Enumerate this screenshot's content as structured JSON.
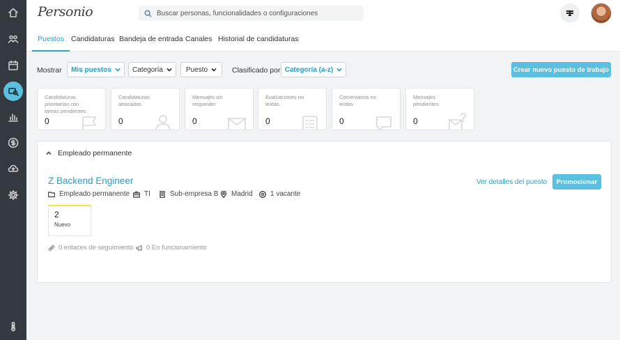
{
  "colors": {
    "accent": "#2a9fc9",
    "button": "#5bbfe0",
    "rail": "#34393f",
    "stage_accent": "#f3e244"
  },
  "rail": [
    {
      "icon": "home-icon"
    },
    {
      "icon": "people-icon"
    },
    {
      "icon": "calendar-icon"
    },
    {
      "icon": "recruiting-icon",
      "active": true
    },
    {
      "icon": "analytics-icon"
    },
    {
      "icon": "payroll-icon"
    },
    {
      "icon": "cloud-upload-icon"
    },
    {
      "icon": "settings-icon"
    },
    {
      "icon": "thermometer-icon"
    }
  ],
  "header": {
    "logo": "Personio",
    "search_placeholder": "Buscar personas, funcionalidades o configuraciones"
  },
  "tabs": [
    "Puestos",
    "Candidaturas",
    "Bandeja de entrada",
    "Canales",
    "Historial de candidaturas"
  ],
  "filters": {
    "show_label": "Mostrar",
    "my_jobs": "Mis puestos",
    "category": "Categoría",
    "job": "Puesto",
    "sort_label": "Clasificado por",
    "sort_value": "Categoría (a-z)",
    "create_button": "Crear nuevo puesto de trabajo"
  },
  "stats": [
    {
      "label": "Candidaturas prioritarias con tareas pendientes",
      "value": "0",
      "icon": "flag-icon"
    },
    {
      "label": "Candidaturas atrasadas",
      "value": "0",
      "icon": "person-icon"
    },
    {
      "label": "Mensajes sin responder",
      "value": "0",
      "icon": "envelope-icon"
    },
    {
      "label": "Evaluaciones no leídas",
      "value": "0",
      "icon": "clipboard-icon"
    },
    {
      "label": "Comentarios no leídos",
      "value": "0",
      "icon": "comment-icon"
    },
    {
      "label": "Mensajes pendientes",
      "value": "0",
      "icon": "envelope-question-icon"
    }
  ],
  "section": {
    "title": "Empleado permanente",
    "job": {
      "title": "Z Backend Engineer",
      "employment": "Empleado permanente",
      "department": "TI",
      "company": "Sub-empresa B",
      "location": "Madrid",
      "vacancies": "1 vacante",
      "details_link": "Ver detalles del puesto",
      "promote_button": "Promocionar",
      "stage": {
        "count": "2",
        "label": "Nuevo"
      },
      "tracking_links": "0 enlaces de seguimiento",
      "running": "0 En funcionamiento"
    }
  }
}
